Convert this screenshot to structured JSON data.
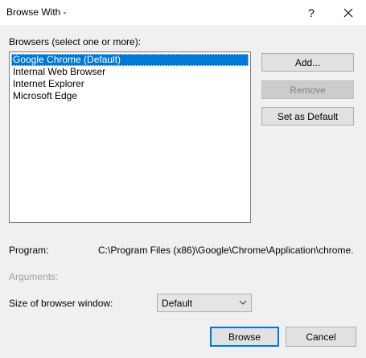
{
  "window": {
    "title": "Browse With -",
    "help_label": "?",
    "close_label": "✕"
  },
  "browsers": {
    "label": "Browsers (select one or more):",
    "items": [
      {
        "label": "Google Chrome (Default)",
        "selected": true
      },
      {
        "label": "Internal Web Browser",
        "selected": false
      },
      {
        "label": "Internet Explorer",
        "selected": false
      },
      {
        "label": "Microsoft Edge",
        "selected": false
      }
    ]
  },
  "buttons": {
    "add": "Add...",
    "remove": "Remove",
    "set_default": "Set as Default",
    "browse": "Browse",
    "cancel": "Cancel"
  },
  "program": {
    "label": "Program:",
    "value": "C:\\Program Files (x86)\\Google\\Chrome\\Application\\chrome."
  },
  "arguments": {
    "label": "Arguments:"
  },
  "window_size": {
    "label": "Size of browser window:",
    "selected": "Default"
  },
  "colors": {
    "accent": "#0078d7",
    "dialog_bg": "#f0f0f0"
  }
}
